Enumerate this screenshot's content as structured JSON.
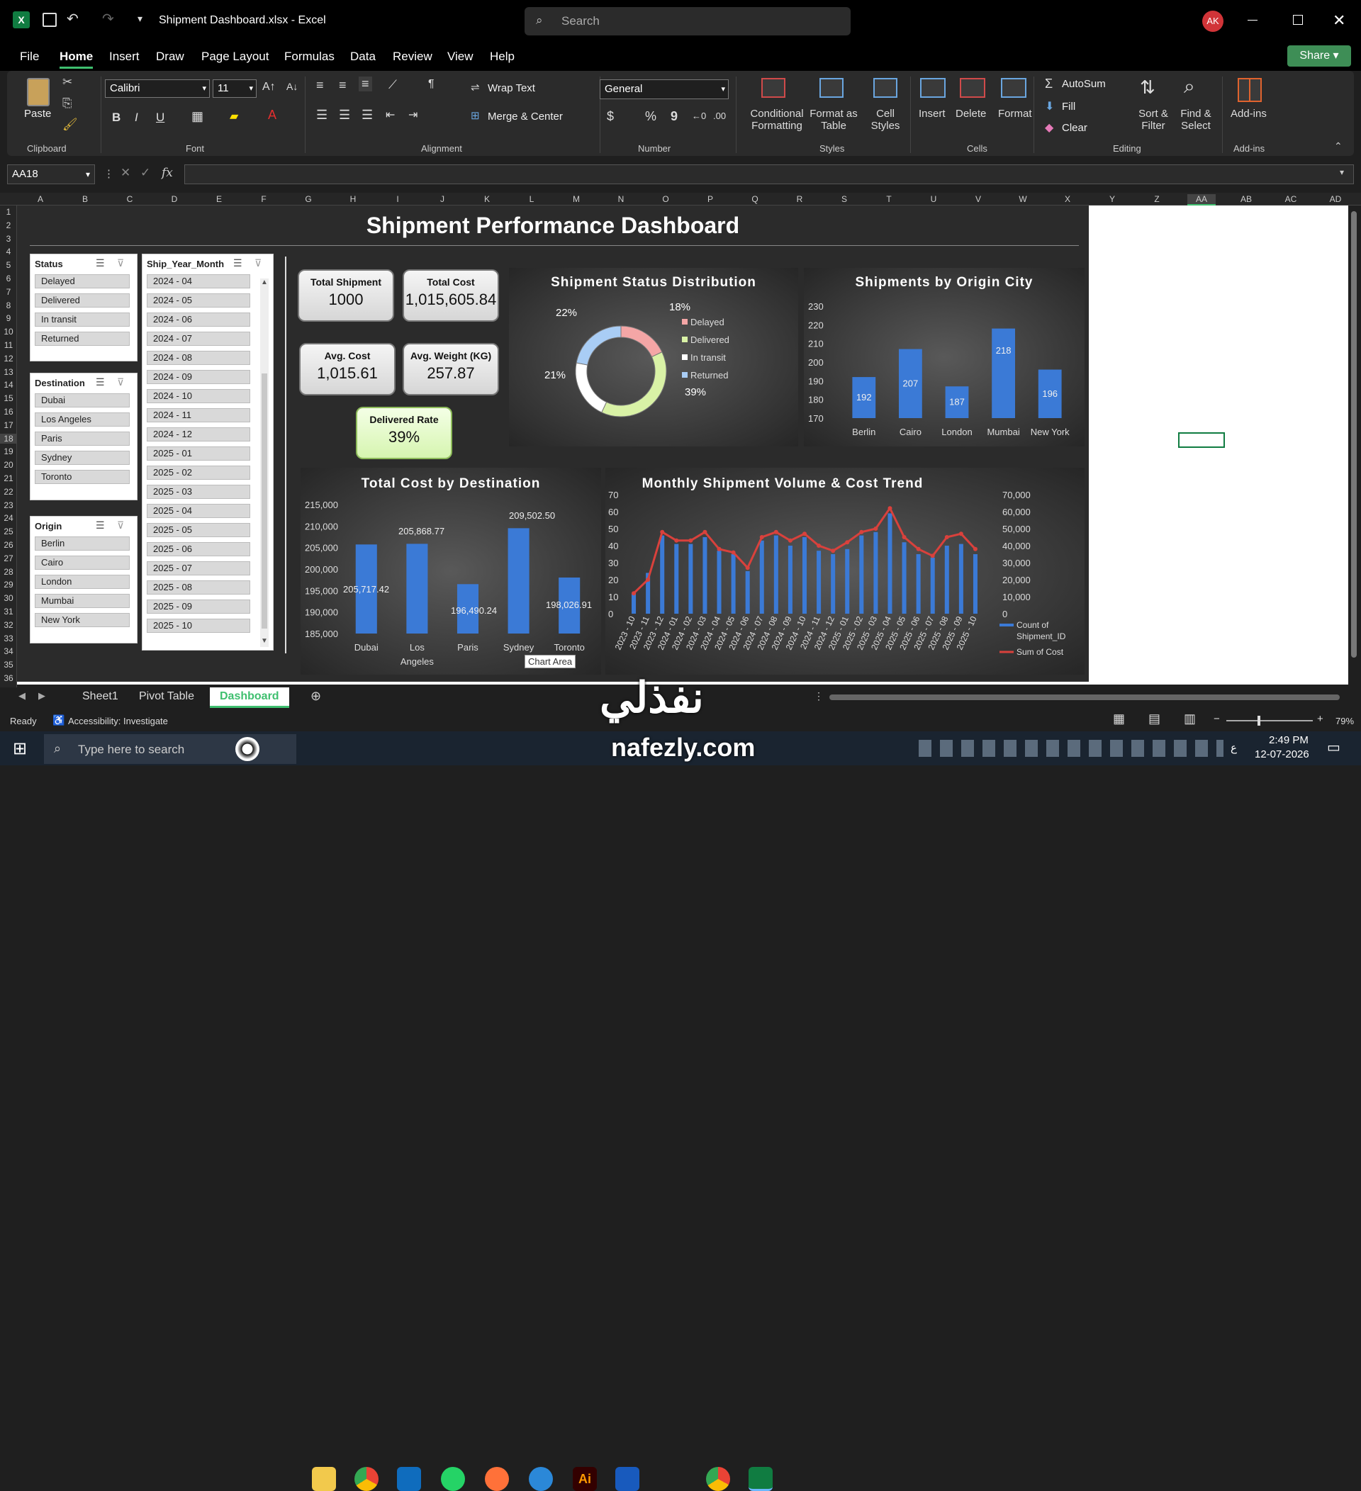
{
  "window": {
    "title": "Shipment Dashboard.xlsx  -  Excel",
    "search_placeholder": "Search",
    "avatar": "AK"
  },
  "menu": [
    "File",
    "Home",
    "Insert",
    "Draw",
    "Page Layout",
    "Formulas",
    "Data",
    "Review",
    "View",
    "Help"
  ],
  "share_label": "Share",
  "ribbon": {
    "clipboard": {
      "paste": "Paste",
      "group": "Clipboard"
    },
    "font": {
      "name": "Calibri",
      "size": "11",
      "group": "Font",
      "bold": "B",
      "italic": "I",
      "underline": "U"
    },
    "alignment": {
      "wrap": "Wrap Text",
      "merge": "Merge & Center",
      "group": "Alignment"
    },
    "number": {
      "format": "General",
      "group": "Number",
      "currency": "$",
      "percent": "%",
      "comma": "9"
    },
    "styles": {
      "conditional": "Conditional Formatting",
      "format_table": "Format as Table",
      "cell_styles": "Cell Styles",
      "group": "Styles"
    },
    "cells": {
      "insert": "Insert",
      "delete": "Delete",
      "format": "Format",
      "group": "Cells"
    },
    "editing": {
      "autosum": "AutoSum",
      "fill": "Fill",
      "clear": "Clear",
      "sort": "Sort & Filter",
      "find": "Find & Select",
      "group": "Editing"
    },
    "addins": {
      "label": "Add-ins",
      "group": "Add-ins"
    }
  },
  "formula": {
    "namebox": "AA18",
    "fx": "fx"
  },
  "columns": [
    "A",
    "B",
    "C",
    "D",
    "E",
    "F",
    "G",
    "H",
    "I",
    "J",
    "K",
    "L",
    "M",
    "N",
    "O",
    "P",
    "Q",
    "R",
    "S",
    "T",
    "U",
    "V",
    "W",
    "X",
    "Y",
    "Z",
    "AA",
    "AB",
    "AC",
    "AD"
  ],
  "rows": [
    "1",
    "2",
    "3",
    "4",
    "5",
    "6",
    "7",
    "8",
    "9",
    "10",
    "11",
    "12",
    "13",
    "14",
    "15",
    "16",
    "17",
    "18",
    "19",
    "20",
    "21",
    "22",
    "23",
    "24",
    "25",
    "26",
    "27",
    "28",
    "29",
    "30",
    "31",
    "32",
    "33",
    "34",
    "35",
    "36"
  ],
  "dashboard": {
    "title": "Shipment Performance Dashboard"
  },
  "slicers": {
    "status": {
      "title": "Status",
      "items": [
        "Delayed",
        "Delivered",
        "In transit",
        "Returned"
      ]
    },
    "destination": {
      "title": "Destination",
      "items": [
        "Dubai",
        "Los Angeles",
        "Paris",
        "Sydney",
        "Toronto"
      ]
    },
    "origin": {
      "title": "Origin",
      "items": [
        "Berlin",
        "Cairo",
        "London",
        "Mumbai",
        "New York"
      ]
    },
    "month": {
      "title": "Ship_Year_Month",
      "items": [
        "2024 - 04",
        "2024 - 05",
        "2024 - 06",
        "2024 - 07",
        "2024 - 08",
        "2024 - 09",
        "2024 - 10",
        "2024 - 11",
        "2024 - 12",
        "2025 - 01",
        "2025 - 02",
        "2025 - 03",
        "2025 - 04",
        "2025 - 05",
        "2025 - 06",
        "2025 - 07",
        "2025 - 08",
        "2025 - 09",
        "2025 - 10"
      ]
    }
  },
  "kpis": {
    "total_shipment": {
      "label": "Total Shipment",
      "value": "1000"
    },
    "total_cost": {
      "label": "Total Cost",
      "value": "1,015,605.84"
    },
    "avg_cost": {
      "label": "Avg. Cost",
      "value": "1,015.61"
    },
    "avg_weight": {
      "label": "Avg. Weight (KG)",
      "value": "257.87"
    },
    "delivered_rate": {
      "label": "Delivered Rate",
      "value": "39%"
    }
  },
  "chart_data": [
    {
      "type": "pie",
      "title": "Shipment Status Distribution",
      "categories": [
        "Delayed",
        "Delivered",
        "In transit",
        "Returned"
      ],
      "values": [
        18,
        39,
        21,
        22
      ],
      "labels": [
        "18%",
        "39%",
        "21%",
        "22%"
      ],
      "colors": [
        "#f4a6a6",
        "#d9f2a6",
        "#ffffff",
        "#a9cdf5"
      ]
    },
    {
      "type": "bar",
      "title": "Shipments by Origin City",
      "categories": [
        "Berlin",
        "Cairo",
        "London",
        "Mumbai",
        "New York"
      ],
      "values": [
        192,
        207,
        187,
        218,
        196
      ],
      "ylim": [
        170,
        230
      ],
      "yticks": [
        "230",
        "220",
        "210",
        "200",
        "190",
        "180",
        "170"
      ]
    },
    {
      "type": "bar",
      "title": "Total Cost by Destination",
      "categories": [
        "Dubai",
        "Los Angeles",
        "Paris",
        "Sydney",
        "Toronto"
      ],
      "values": [
        205717.42,
        205868.77,
        196490.24,
        209502.5,
        198026.91
      ],
      "labels": [
        "205,717.42",
        "205,868.77",
        "196,490.24",
        "209,502.50",
        "198,026.91"
      ],
      "ylim": [
        185000,
        215000
      ],
      "yticks": [
        "215,000",
        "210,000",
        "205,000",
        "200,000",
        "195,000",
        "190,000",
        "185,000"
      ]
    },
    {
      "type": "line",
      "title": "Monthly Shipment Volume & Cost Trend",
      "categories": [
        "2023 - 10",
        "2023 - 11",
        "2023 - 12",
        "2024 - 01",
        "2024 - 02",
        "2024 - 03",
        "2024 - 04",
        "2024 - 05",
        "2024 - 06",
        "2024 - 07",
        "2024 - 08",
        "2024 - 09",
        "2024 - 10",
        "2024 - 11",
        "2024 - 12",
        "2025 - 01",
        "2025 - 02",
        "2025 - 03",
        "2025 - 04",
        "2025 - 05",
        "2025 - 06",
        "2025 - 07",
        "2025 - 08",
        "2025 - 09",
        "2025 - 10"
      ],
      "series": [
        {
          "name": "Count of Shipment_ID",
          "values": [
            12,
            24,
            46,
            41,
            41,
            45,
            37,
            35,
            25,
            43,
            46,
            40,
            45,
            37,
            35,
            38,
            46,
            48,
            59,
            42,
            35,
            33,
            40,
            41,
            35
          ]
        },
        {
          "name": "Sum of Cost",
          "values": [
            12000,
            20000,
            48000,
            43000,
            43000,
            48000,
            38000,
            36000,
            27000,
            45000,
            48000,
            43000,
            47000,
            40000,
            37000,
            42000,
            48000,
            50000,
            62000,
            45000,
            38000,
            34000,
            45000,
            47000,
            38000
          ]
        }
      ],
      "ylim_left": [
        0,
        70
      ],
      "ylim_right": [
        0,
        70000
      ],
      "yticks_left": [
        "70",
        "60",
        "50",
        "40",
        "30",
        "20",
        "10",
        "0"
      ],
      "yticks_right": [
        "70,000",
        "60,000",
        "50,000",
        "40,000",
        "30,000",
        "20,000",
        "10,000",
        "0"
      ]
    }
  ],
  "chart_area_tooltip": "Chart Area",
  "sheets": [
    "Sheet1",
    "Pivot Table",
    "Dashboard"
  ],
  "status": {
    "ready": "Ready",
    "accessibility": "Accessibility: Investigate",
    "zoom": "79%"
  },
  "taskbar": {
    "search_placeholder": "Type here to search",
    "time": "2:49 PM",
    "date": "12-07-2026",
    "lang": "ع"
  },
  "watermark": {
    "arabic": "نفذلي",
    "latin": "nafezly.com"
  }
}
